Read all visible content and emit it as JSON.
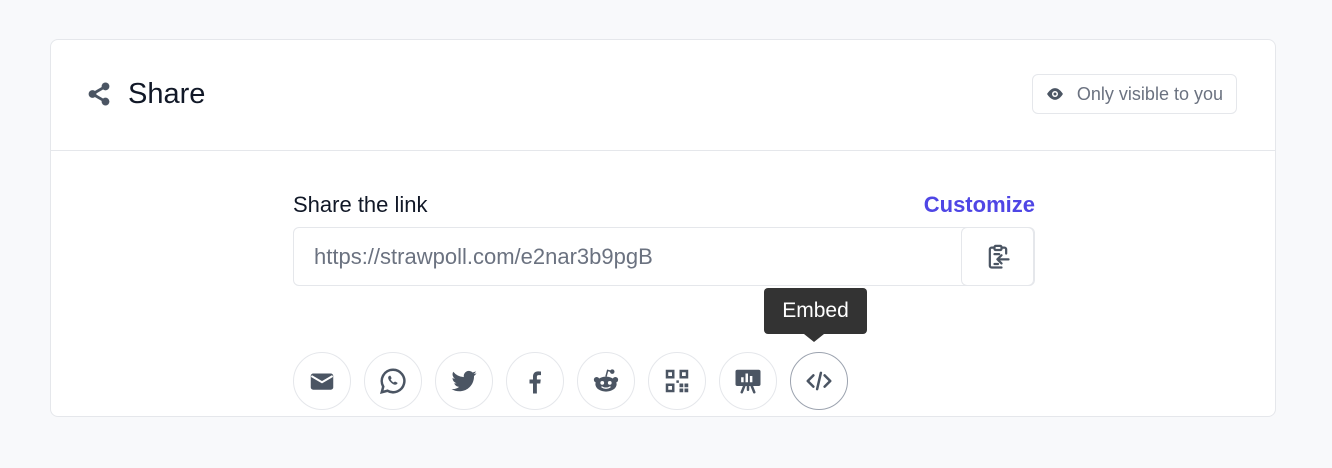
{
  "header": {
    "title": "Share",
    "title_icon": "share-icon",
    "visibility_icon": "eye-icon",
    "visibility_label": "Only visible to you"
  },
  "link_section": {
    "label": "Share the link",
    "customize_label": "Customize",
    "link_value": "https://strawpoll.com/e2nar3b9pgB",
    "copy_icon": "clipboard-copy-icon"
  },
  "tooltip": {
    "text": "Embed"
  },
  "share_buttons": [
    {
      "name": "email",
      "icon": "envelope-icon"
    },
    {
      "name": "whatsapp",
      "icon": "whatsapp-icon"
    },
    {
      "name": "twitter",
      "icon": "twitter-icon"
    },
    {
      "name": "facebook",
      "icon": "facebook-icon"
    },
    {
      "name": "reddit",
      "icon": "reddit-icon"
    },
    {
      "name": "qr-code",
      "icon": "qr-code-icon"
    },
    {
      "name": "presentation",
      "icon": "presentation-icon"
    },
    {
      "name": "embed",
      "icon": "code-icon"
    }
  ],
  "colors": {
    "accent": "#4f46e5",
    "icon_gray": "#4b5563",
    "tooltip_bg": "#333333",
    "border": "#e5e7eb"
  }
}
